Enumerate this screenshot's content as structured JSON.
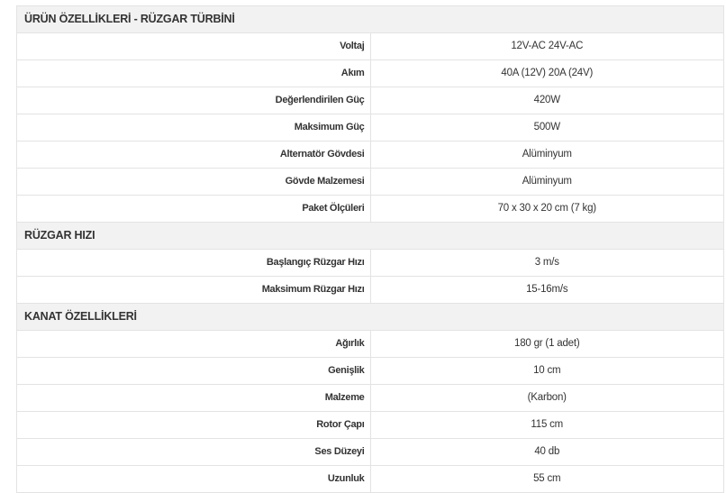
{
  "sections": [
    {
      "title": "ÜRÜN ÖZELLİKLERİ - RÜZGAR TÜRBİNİ",
      "rows": [
        {
          "label": "Voltaj",
          "value": "12V-AC 24V-AC"
        },
        {
          "label": "Akım",
          "value": "40A (12V) 20A (24V)"
        },
        {
          "label": "Değerlendirilen Güç",
          "value": "420W"
        },
        {
          "label": "Maksimum Güç",
          "value": "500W"
        },
        {
          "label": "Alternatör Gövdesi",
          "value": "Alüminyum"
        },
        {
          "label": "Gövde Malzemesi",
          "value": "Alüminyum"
        },
        {
          "label": "Paket Ölçüleri",
          "value": "70 x 30 x 20 cm (7 kg)"
        }
      ]
    },
    {
      "title": "RÜZGAR HIZI",
      "rows": [
        {
          "label": "Başlangıç Rüzgar Hızı",
          "value": "3 m/s"
        },
        {
          "label": "Maksimum Rüzgar Hızı",
          "value": "15-16m/s"
        }
      ]
    },
    {
      "title": "KANAT ÖZELLİKLERİ",
      "rows": [
        {
          "label": "Ağırlık",
          "value": "180 gr (1 adet)"
        },
        {
          "label": "Genişlik",
          "value": "10 cm"
        },
        {
          "label": "Malzeme",
          "value": "(Karbon)"
        },
        {
          "label": "Rotor Çapı",
          "value": "115 cm"
        },
        {
          "label": "Ses Düzeyi",
          "value": "40 db"
        },
        {
          "label": "Uzunluk",
          "value": "55 cm"
        }
      ]
    }
  ]
}
